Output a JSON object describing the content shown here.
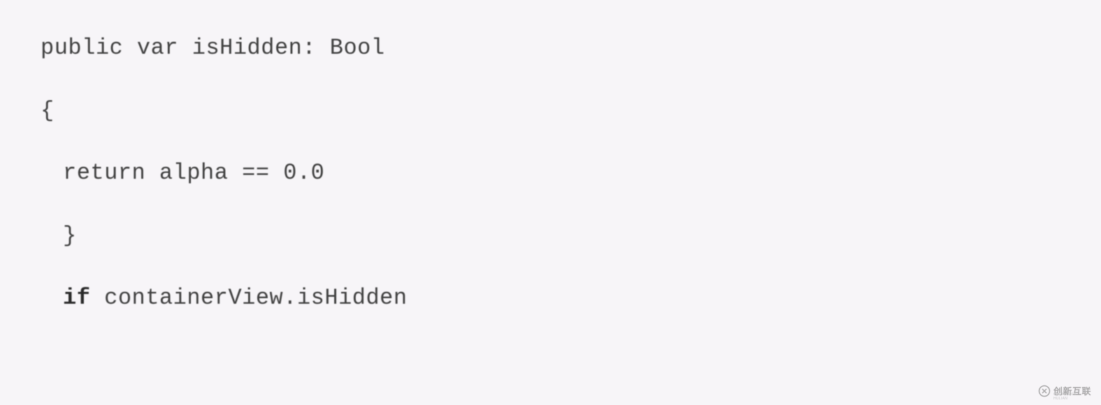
{
  "code": {
    "line1": "public var isHidden: Bool",
    "line2": "{",
    "line3": "return alpha == 0.0",
    "line4": "}",
    "line5_keyword": "if",
    "line5_rest": " containerView.isHidden"
  },
  "watermark": {
    "text": "创新互联",
    "sub": "CHUANGXIN HULIAN"
  }
}
